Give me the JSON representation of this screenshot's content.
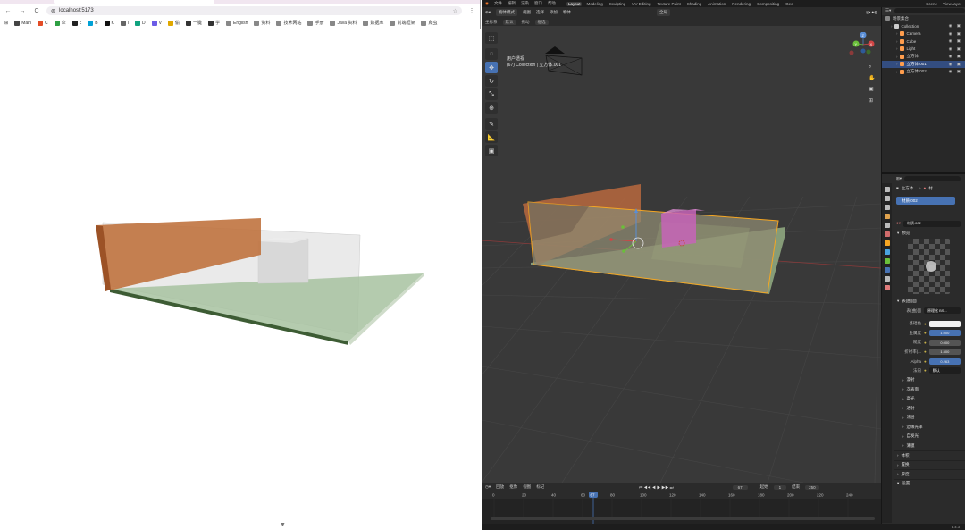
{
  "browser": {
    "nav": {
      "back": "←",
      "forward": "→",
      "reload": "C",
      "menu": "⋮"
    },
    "url": "localhost:5173",
    "bookmarks": [
      {
        "label": "Main",
        "color": "#444444"
      },
      {
        "label": "C",
        "color": "#e34c26"
      },
      {
        "label": "众",
        "color": "#2ea043"
      },
      {
        "label": "c",
        "color": "#222222"
      },
      {
        "label": "B",
        "color": "#00a1d6"
      },
      {
        "label": "K",
        "color": "#111111"
      },
      {
        "label": "i",
        "color": "#666666"
      },
      {
        "label": "D",
        "color": "#10a37f"
      },
      {
        "label": "V",
        "color": "#6c5ce7"
      },
      {
        "label": "偷",
        "color": "#e0a800"
      },
      {
        "label": "一键",
        "color": "#333333"
      },
      {
        "label": "学",
        "color": "#333333"
      },
      {
        "label": "English",
        "color": "#888888"
      },
      {
        "label": "资料",
        "color": "#888888"
      },
      {
        "label": "技术网站",
        "color": "#888888"
      },
      {
        "label": "手册",
        "color": "#888888"
      },
      {
        "label": "Java 资料",
        "color": "#888888"
      },
      {
        "label": "数据库",
        "color": "#888888"
      },
      {
        "label": "前端框架",
        "color": "#888888"
      },
      {
        "label": "爬虫",
        "color": "#888888"
      }
    ]
  },
  "blender": {
    "topbar": {
      "menus": [
        "文件",
        "编辑",
        "渲染",
        "窗口",
        "帮助"
      ],
      "workspaces": [
        "Layout",
        "Modeling",
        "Sculpting",
        "UV Editing",
        "Texture Paint",
        "Shading",
        "Animation",
        "Rendering",
        "Compositing",
        "Geo"
      ],
      "active_workspace": "Layout",
      "scene": "Scene",
      "viewlayer": "ViewLayer"
    },
    "viewport_header": {
      "mode": "物体模式",
      "menus": [
        "视图",
        "选择",
        "添加",
        "物体"
      ],
      "orientation": "全局",
      "coord_label": "坐标系",
      "coord_value": "默认",
      "drag_label": "拖动",
      "drag_value": "框选"
    },
    "viewport_info": {
      "line1": "用户透视",
      "line2": "(67) Collection | 立方体.001"
    },
    "toolbar_icons": [
      "select-box-icon",
      "cursor-icon",
      "move-icon",
      "rotate-icon",
      "scale-icon",
      "transform-icon",
      "annotate-icon",
      "measure-icon",
      "add-cube-icon"
    ],
    "gizmo": {
      "x": "X",
      "y": "Y",
      "z": "Z"
    },
    "timeline": {
      "menus": [
        "回放",
        "抠像",
        "视图",
        "标记"
      ],
      "current_frame": "67",
      "start_label": "起始",
      "start": "1",
      "end_label": "结束",
      "end": "250",
      "ticks": [
        "0",
        "20",
        "40",
        "60",
        "80",
        "100",
        "120",
        "140",
        "160",
        "180",
        "200",
        "220",
        "240"
      ]
    },
    "status_version": "4.4.3",
    "outliner": {
      "title": "场景集合",
      "search_placeholder": "",
      "rows": [
        {
          "label": "Collection",
          "indent": 1,
          "color": "#cccccc",
          "selected": false
        },
        {
          "label": "Camera",
          "indent": 2,
          "color": "#ff9d4d",
          "selected": false
        },
        {
          "label": "Cube",
          "indent": 2,
          "color": "#ff9d4d",
          "selected": false
        },
        {
          "label": "Light",
          "indent": 2,
          "color": "#ff9d4d",
          "selected": false
        },
        {
          "label": "立方体",
          "indent": 2,
          "color": "#ff9d4d",
          "selected": false
        },
        {
          "label": "立方体.001",
          "indent": 2,
          "color": "#ff9d4d",
          "selected": true
        },
        {
          "label": "立方体.002",
          "indent": 2,
          "color": "#ff9d4d",
          "selected": false
        }
      ]
    },
    "properties": {
      "object_label": "立方体...",
      "material_label": "材...",
      "material_slot": "材质.002",
      "material_field": "材质.002",
      "preview_label": "预览",
      "surface_label": "表(曲)面",
      "surface_type_label": "表(曲)面",
      "surface_type_value": "原理化 BS...",
      "fields": [
        {
          "label": "基础色",
          "value": "",
          "style": "white"
        },
        {
          "label": "金属度",
          "value": "1.000",
          "style": "blue"
        },
        {
          "label": "糙度",
          "value": "0.000",
          "style": "grey"
        },
        {
          "label": "折射率(...",
          "value": "1.500",
          "style": "grey"
        },
        {
          "label": "Alpha",
          "value": "0.263",
          "style": "blue"
        },
        {
          "label": "法向",
          "value": "默认",
          "style": "dark"
        }
      ],
      "subpanels": [
        "漫射",
        "次表面",
        "高光",
        "透射",
        "涂层",
        "边缘光泽",
        "自发光",
        "薄膜"
      ],
      "sections": [
        "体积",
        "置换",
        "厚度",
        "设置"
      ]
    }
  },
  "colors": {
    "blender_bg": "#2a2a2a",
    "viewport_bg": "#393939",
    "accent_blue": "#4772b3",
    "selection_orange": "#f5a623",
    "wall_orange": "#b8683e",
    "floor_green": "#9cb894"
  }
}
